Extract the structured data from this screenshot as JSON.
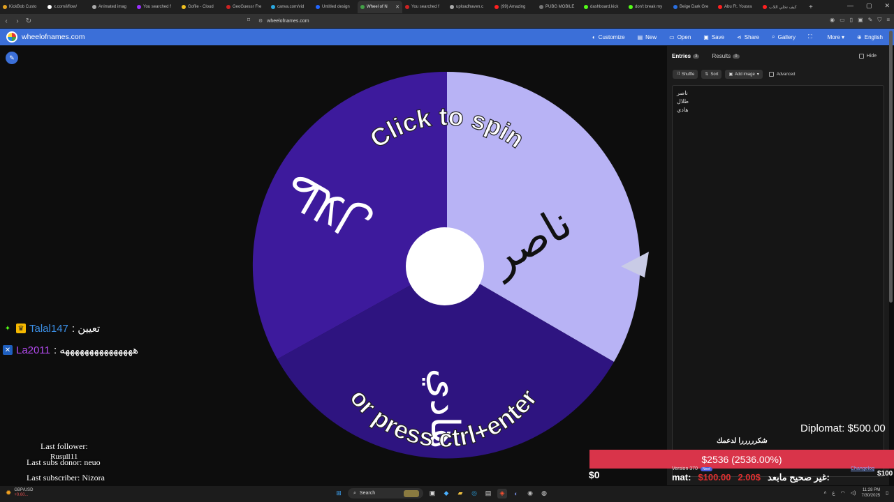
{
  "browser": {
    "tabs": [
      {
        "label": "KickBob Custo",
        "color": "#e0a020"
      },
      {
        "label": "x.com/i/flow/",
        "color": "#ffffff"
      },
      {
        "label": "Animated imag",
        "color": "#aaaaaa"
      },
      {
        "label": "You searched f",
        "color": "#9b30ff"
      },
      {
        "label": "Gofile - Cloud",
        "color": "#f0c020"
      },
      {
        "label": "GeoGuessr Fre",
        "color": "#cc2222"
      },
      {
        "label": "canva.com/vid",
        "color": "#2aa8e0"
      },
      {
        "label": "Untitled design",
        "color": "#2266ff"
      },
      {
        "label": "Wheel of N",
        "color": "#43a047",
        "active": true
      },
      {
        "label": "You searched f",
        "color": "#cc2222"
      },
      {
        "label": "uploadhaven.c",
        "color": "#aaaaaa"
      },
      {
        "label": "(99) Amazing",
        "color": "#ff2020"
      },
      {
        "label": "PUBG MOBILE",
        "color": "#777777"
      },
      {
        "label": "dashboard.kick",
        "color": "#53fc18"
      },
      {
        "label": "don't break my",
        "color": "#53fc18"
      },
      {
        "label": "Beige Dark Gre",
        "color": "#2a6fe0"
      },
      {
        "label": "Abu Ft. Yousra",
        "color": "#ff2020"
      },
      {
        "label": "كيف تخلي اللاب",
        "color": "#ff2020"
      }
    ],
    "url": "wheelofnames.com"
  },
  "site": {
    "name": "wheelofnames.com",
    "menu": [
      {
        "icon": "palette-icon",
        "glyph": "◐",
        "label": "Customize"
      },
      {
        "icon": "new-file-icon",
        "glyph": "▤",
        "label": "New"
      },
      {
        "icon": "folder-icon",
        "glyph": "▭",
        "label": "Open"
      },
      {
        "icon": "save-icon",
        "glyph": "▣",
        "label": "Save"
      },
      {
        "icon": "share-icon",
        "glyph": "⋖",
        "label": "Share"
      },
      {
        "icon": "search-icon",
        "glyph": "⌕",
        "label": "Gallery"
      },
      {
        "icon": "fullscreen-icon",
        "glyph": "⛶",
        "label": ""
      },
      {
        "icon": "more-icon",
        "glyph": "",
        "label": "More ▾"
      },
      {
        "icon": "globe-icon",
        "glyph": "⊕",
        "label": "English"
      }
    ]
  },
  "wheel": {
    "top_text": "Click to spin",
    "bottom_text": "or press ctrl+enter",
    "segments": [
      {
        "label": "ناصر",
        "color": "#b8b3f5"
      },
      {
        "label": "طلال",
        "color": "#2e1480"
      },
      {
        "label": "هادي",
        "color": "#3d1a9c"
      }
    ],
    "pointer_color": "#c9cbe6"
  },
  "panel": {
    "tab_entries": "Entries",
    "entries_count": "3",
    "tab_results": "Results",
    "results_count": "0",
    "hide_label": "Hide",
    "tools": {
      "shuffle": "Shuffle",
      "sort": "Sort",
      "add_image": "Add image",
      "advanced": "Advanced"
    },
    "entries": [
      "ناصر",
      "طلال",
      "هادي"
    ]
  },
  "overlay": {
    "chat": [
      {
        "user": "Talal147",
        "message": ": تعيين"
      },
      {
        "user": "La2011",
        "message": ": هههههههههههههههه"
      }
    ],
    "last_follower": "Last follower:",
    "last_follower_name": "Rusull11",
    "last_subs_donor": "Last subs donor: neuo",
    "last_subscriber": "Last subscriber: Nizora",
    "thanks_text": "شكرررررا لدعمك",
    "goal": "$2536 (2536.00%)",
    "goal_min": "$0",
    "goal_max": "$100",
    "diplomat": "Diplomat: $500.00",
    "version": "Version 370",
    "new_badge": "New!",
    "changelog": "Changelog",
    "ticker_prefix": "mat:",
    "ticker_amount1": "$100.00",
    "ticker_amount2": "2.00$",
    "ticker_text": "غير صحيح مابعد:"
  },
  "taskbar": {
    "weather_pair": "GBP/USD",
    "weather_value": "+0.60...",
    "search": "Search",
    "time": "11:28 PM",
    "date": "7/30/2025"
  }
}
